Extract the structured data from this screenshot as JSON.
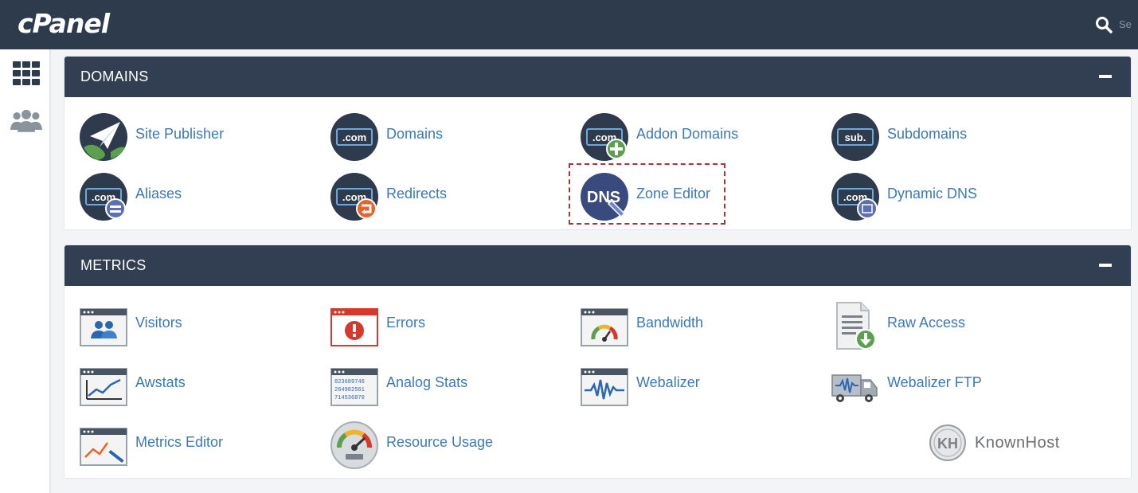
{
  "app": {
    "logo": "cPanel",
    "search_placeholder": "Se"
  },
  "sidebar": {
    "items": [
      {
        "name": "tools-grid-icon"
      },
      {
        "name": "users-icon"
      }
    ]
  },
  "domains": {
    "title": "DOMAINS",
    "items": [
      {
        "label": "Site Publisher",
        "icon": "paper-plane-globe-icon"
      },
      {
        "label": "Domains",
        "icon": "dotcom-icon"
      },
      {
        "label": "Addon Domains",
        "icon": "dotcom-plus-icon"
      },
      {
        "label": "Subdomains",
        "icon": "sub-icon"
      },
      {
        "label": "Aliases",
        "icon": "dotcom-equals-icon"
      },
      {
        "label": "Redirects",
        "icon": "dotcom-redirect-icon"
      },
      {
        "label": "Zone Editor",
        "icon": "dns-icon"
      },
      {
        "label": "Dynamic DNS",
        "icon": "dotcom-dyn-icon"
      }
    ]
  },
  "metrics": {
    "title": "METRICS",
    "items": [
      {
        "label": "Visitors",
        "icon": "visitors-icon"
      },
      {
        "label": "Errors",
        "icon": "errors-icon"
      },
      {
        "label": "Bandwidth",
        "icon": "bandwidth-gauge-icon"
      },
      {
        "label": "Raw Access",
        "icon": "raw-access-icon"
      },
      {
        "label": "Awstats",
        "icon": "awstats-chart-icon"
      },
      {
        "label": "Analog Stats",
        "icon": "analog-stats-icon"
      },
      {
        "label": "Webalizer",
        "icon": "webalizer-icon"
      },
      {
        "label": "Webalizer FTP",
        "icon": "webalizer-ftp-truck-icon"
      },
      {
        "label": "Metrics Editor",
        "icon": "metrics-editor-icon"
      },
      {
        "label": "Resource Usage",
        "icon": "resource-usage-gauge-icon"
      }
    ]
  },
  "analog_stats_digits": [
    "823689746",
    "264982561",
    "714536870"
  ],
  "dns_icon_text": "DNS",
  "com_text": ".com",
  "sub_text": "sub.",
  "watermark": {
    "text": "KnownHost",
    "monogram": "KH"
  },
  "colors": {
    "header": "#2e3b4d",
    "panel_header": "#323f52",
    "link": "#3b79b9",
    "highlight": "#a8353b"
  }
}
